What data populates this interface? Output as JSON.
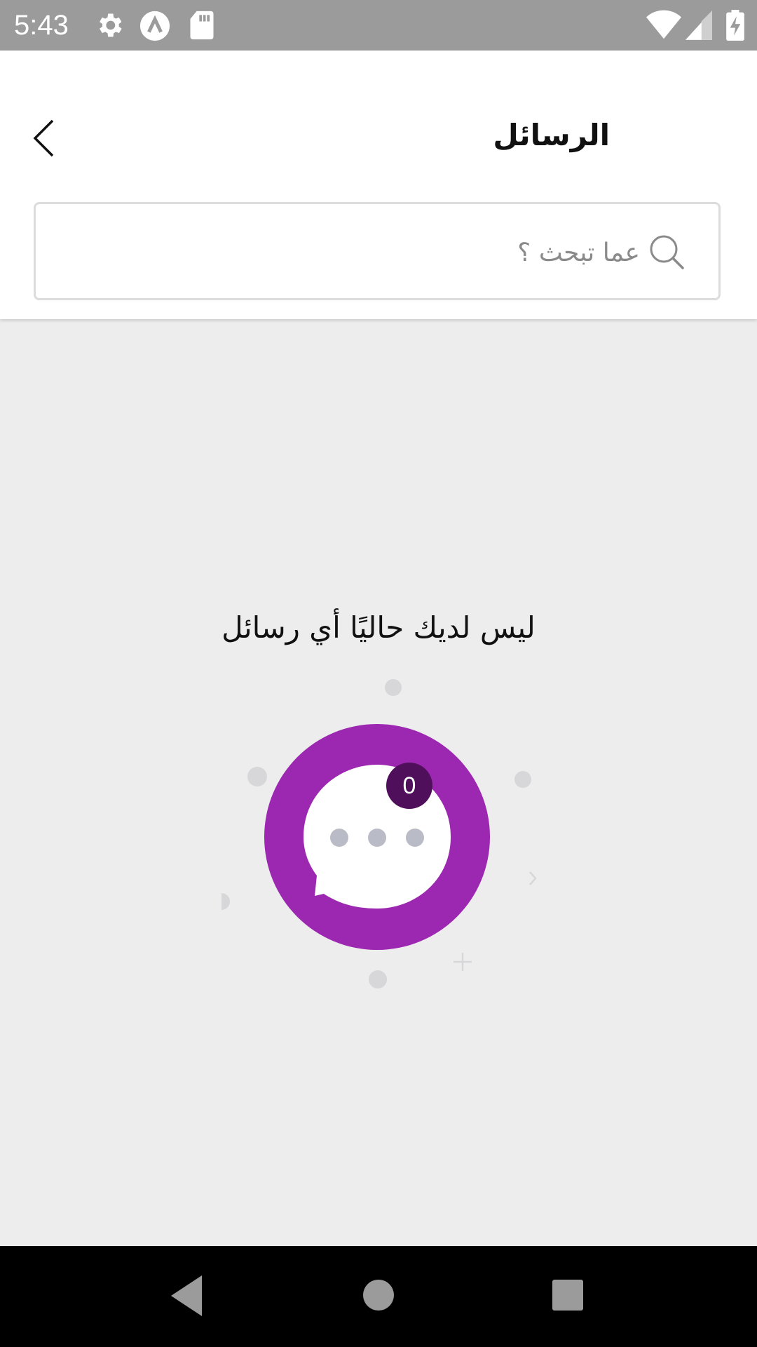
{
  "status_bar": {
    "time": "5:43",
    "icons": [
      "gear-icon",
      "a-badge-icon",
      "sd-card-icon",
      "wifi-icon",
      "signal-icon",
      "battery-charging-icon"
    ]
  },
  "header": {
    "title": "الرسائل",
    "back_icon": "chevron-left-icon"
  },
  "search": {
    "placeholder": "عما تبحث ؟",
    "value": ""
  },
  "empty_state": {
    "message": "ليس لديك حاليًا أي رسائل",
    "badge_count": "0",
    "colors": {
      "ring": "#9c27b0",
      "badge": "#4f0f5a",
      "dots": "#b9bcc6"
    }
  },
  "nav_bar": {
    "items": [
      "back-triangle-icon",
      "home-circle-icon",
      "recents-square-icon"
    ]
  }
}
